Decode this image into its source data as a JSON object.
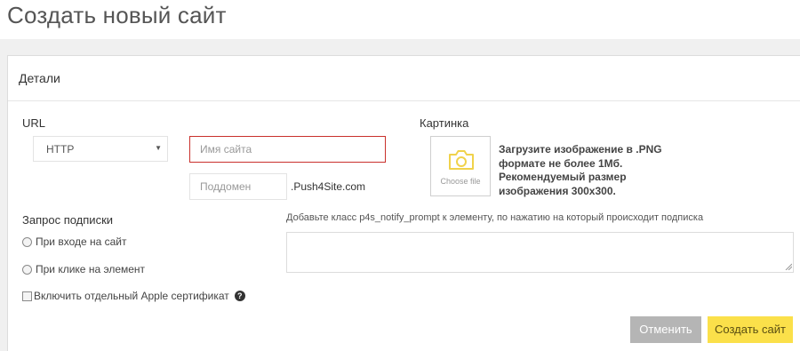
{
  "page": {
    "title": "Создать новый сайт"
  },
  "panel": {
    "title": "Детали"
  },
  "url": {
    "label": "URL",
    "protocol_selected": "HTTP",
    "name_placeholder": "Имя сайта",
    "subdomain_placeholder": "Поддомен",
    "domain_suffix": ".Push4Site.com"
  },
  "image": {
    "label": "Картинка",
    "choose_file": "Choose file",
    "hint": "Загрузите изображение в .PNG формате не более 1Мб. Рекомендуемый размер изображения 300х300.",
    "icon": "camera-icon",
    "icon_color": "#f0d24b"
  },
  "subscription": {
    "label": "Запрос подписки",
    "option_enter": "При входе на сайт",
    "option_click": "При клике на элемент",
    "apple_cert": "Включить отдельный Apple сертификат",
    "help_glyph": "?"
  },
  "prompt": {
    "hint": "Добавьте класс p4s_notify_prompt к элементу, по нажатию на который происходит подписка",
    "value": ""
  },
  "actions": {
    "cancel": "Отменить",
    "create": "Создать сайт"
  },
  "colors": {
    "error_border": "#c9302c",
    "cancel_bg": "#b5b5b5",
    "create_bg": "#fbe04a"
  }
}
